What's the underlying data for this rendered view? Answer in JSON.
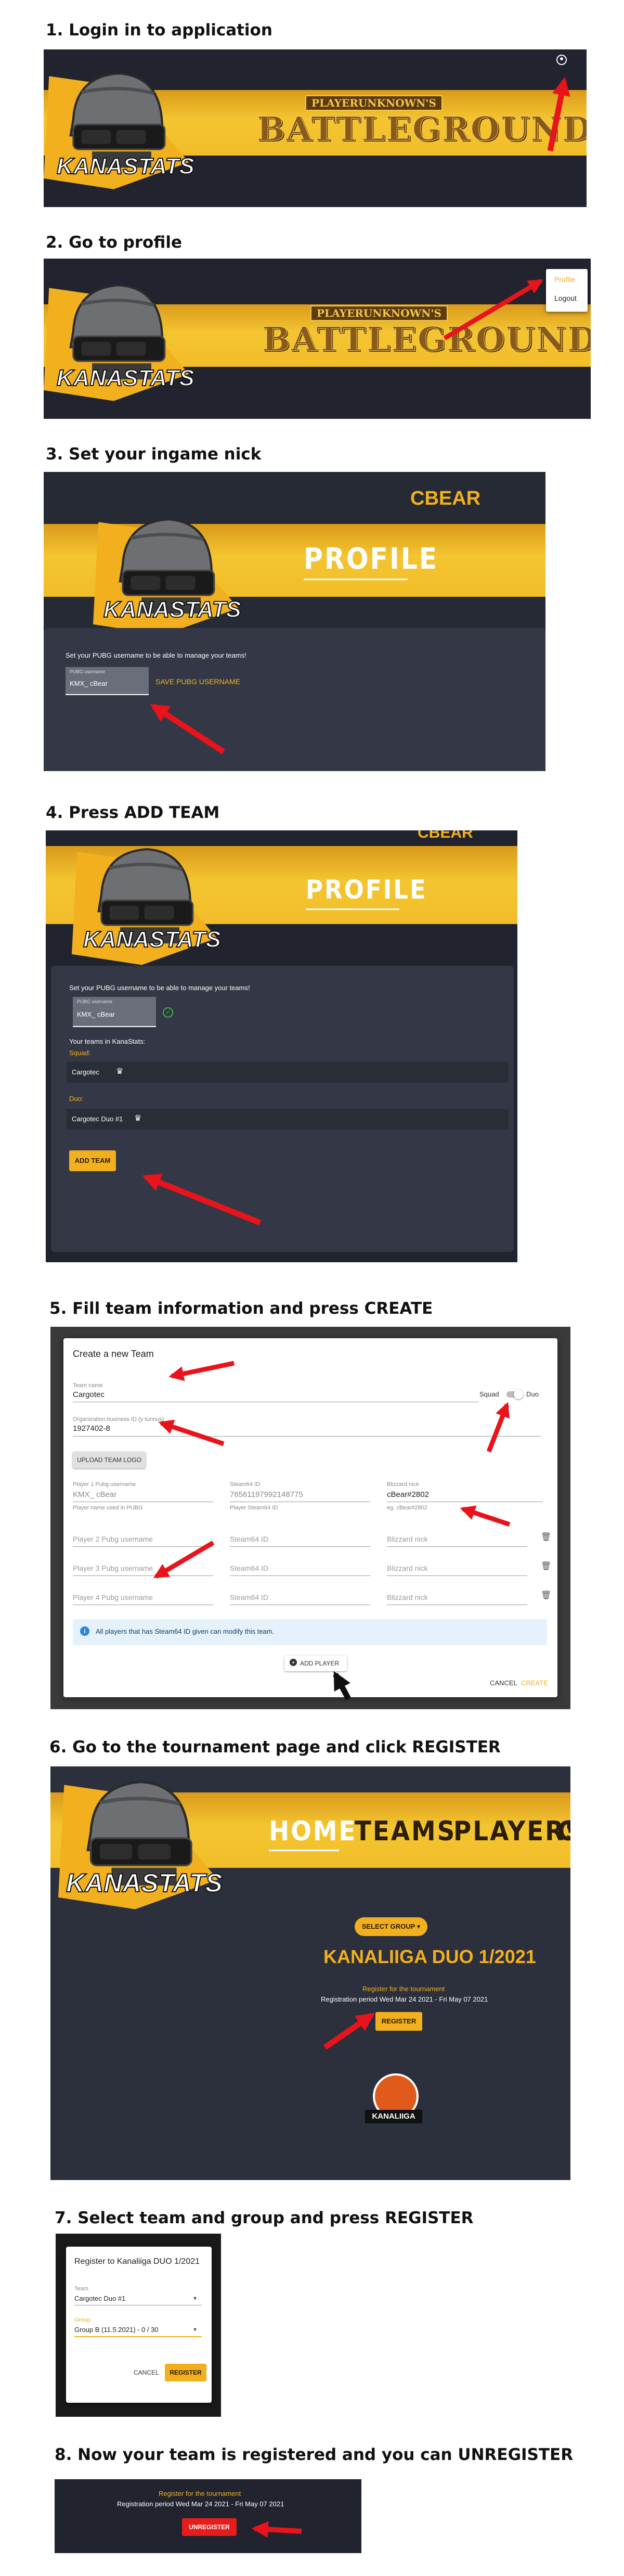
{
  "steps": [
    {
      "title": "1. Login in to application"
    },
    {
      "title": "2. Go to profile"
    },
    {
      "title": "3. Set your ingame nick"
    },
    {
      "title": "4. Press ADD TEAM"
    },
    {
      "title": "5. Fill team information and press CREATE"
    },
    {
      "title": "6. Go to the tournament page and click REGISTER"
    },
    {
      "title": "7. Select team and group and press REGISTER"
    },
    {
      "title": "8. Now your team is registered and you can UNREGISTER"
    }
  ],
  "brand": {
    "logo_text": "KANASTATS",
    "game_top": "PLAYERUNKNOWN'S",
    "game_bottom": "BATTLEGROUNDS"
  },
  "colors": {
    "accent": "#f2b01e",
    "dark_bg": "#21242f",
    "panel": "#343846",
    "arrow": "#e8131b"
  },
  "s2": {
    "menu_profile": "Profile",
    "menu_logout": "Logout"
  },
  "s3": {
    "username_top": "CBEAR",
    "page_heading": "PROFILE",
    "instruction": "Set your PUBG username to be able to manage your teams!",
    "field_label": "PUBG username",
    "field_prefix": "KMX_",
    "field_value": "cBear",
    "save_button": "SAVE PUBG USERNAME"
  },
  "s4": {
    "username_top": "CBEAR",
    "page_heading": "PROFILE",
    "instruction": "Set your PUBG username to be able to manage your teams!",
    "field_label": "PUBG username",
    "field_prefix": "KMX_",
    "field_value": "cBear",
    "teams_heading": "Your teams in KanaStats:",
    "squad_label": "Squad:",
    "squad_team": "Cargotec",
    "duo_label": "Duo:",
    "duo_team": "Cargotec Duo #1",
    "add_team_button": "ADD TEAM"
  },
  "s5": {
    "dialog_title": "Create a new Team",
    "team_name_label": "Team name",
    "team_name_value": "Cargotec",
    "mode_squad": "Squad",
    "mode_duo": "Duo",
    "org_label": "Organization business ID (y-tunnus)",
    "org_value": "1927402-8",
    "upload_button": "UPLOAD TEAM LOGO",
    "p1_pubg_label": "Player 1 Pubg username",
    "p1_pubg_value": "KMX_ cBear",
    "p1_pubg_hint": "Player name used in PUBG",
    "p1_steam_label": "Steam64 ID",
    "p1_steam_value": "76561197992148775",
    "p1_steam_hint": "Player Steam64 ID",
    "p1_blizz_label": "Blizzard nick",
    "p1_blizz_value": "cBear#2802",
    "p1_blizz_hint": "eg. cBear#2802",
    "p2_pubg": "Player 2 Pubg username",
    "p3_pubg": "Player 3 Pubg username",
    "p4_pubg": "Player 4 Pubg username",
    "steam_ph": "Steam64 ID",
    "blizz_ph": "Blizzard nick",
    "info_text": "All players that has Steam64 ID given can modify this team.",
    "add_player_button": "ADD PLAYER",
    "cancel_button": "CANCEL",
    "create_button": "CREATE"
  },
  "s6": {
    "nav": [
      "HOME",
      "TEAMS",
      "PLAYERS",
      "GA"
    ],
    "select_group": "SELECT GROUP",
    "tournament_title": "KANALIIGA DUO 1/2021",
    "register_heading": "Register for the tournament",
    "registration_period": "Registration period Wed Mar 24 2021 - Fri May 07 2021",
    "register_button": "REGISTER",
    "partner_logo": "KANALIIGA"
  },
  "s7": {
    "dialog_title": "Register to Kanaliiga DUO 1/2021",
    "team_label": "Team",
    "team_value": "Cargotec Duo #1",
    "group_label": "Group",
    "group_value": "Group B (11.5.2021) - 0 / 30",
    "cancel_button": "CANCEL",
    "register_button": "REGISTER"
  },
  "s8": {
    "register_heading": "Register for the tournament",
    "registration_period": "Registration period Wed Mar 24 2021 - Fri May 07 2021",
    "unregister_button": "UNREGISTER"
  }
}
